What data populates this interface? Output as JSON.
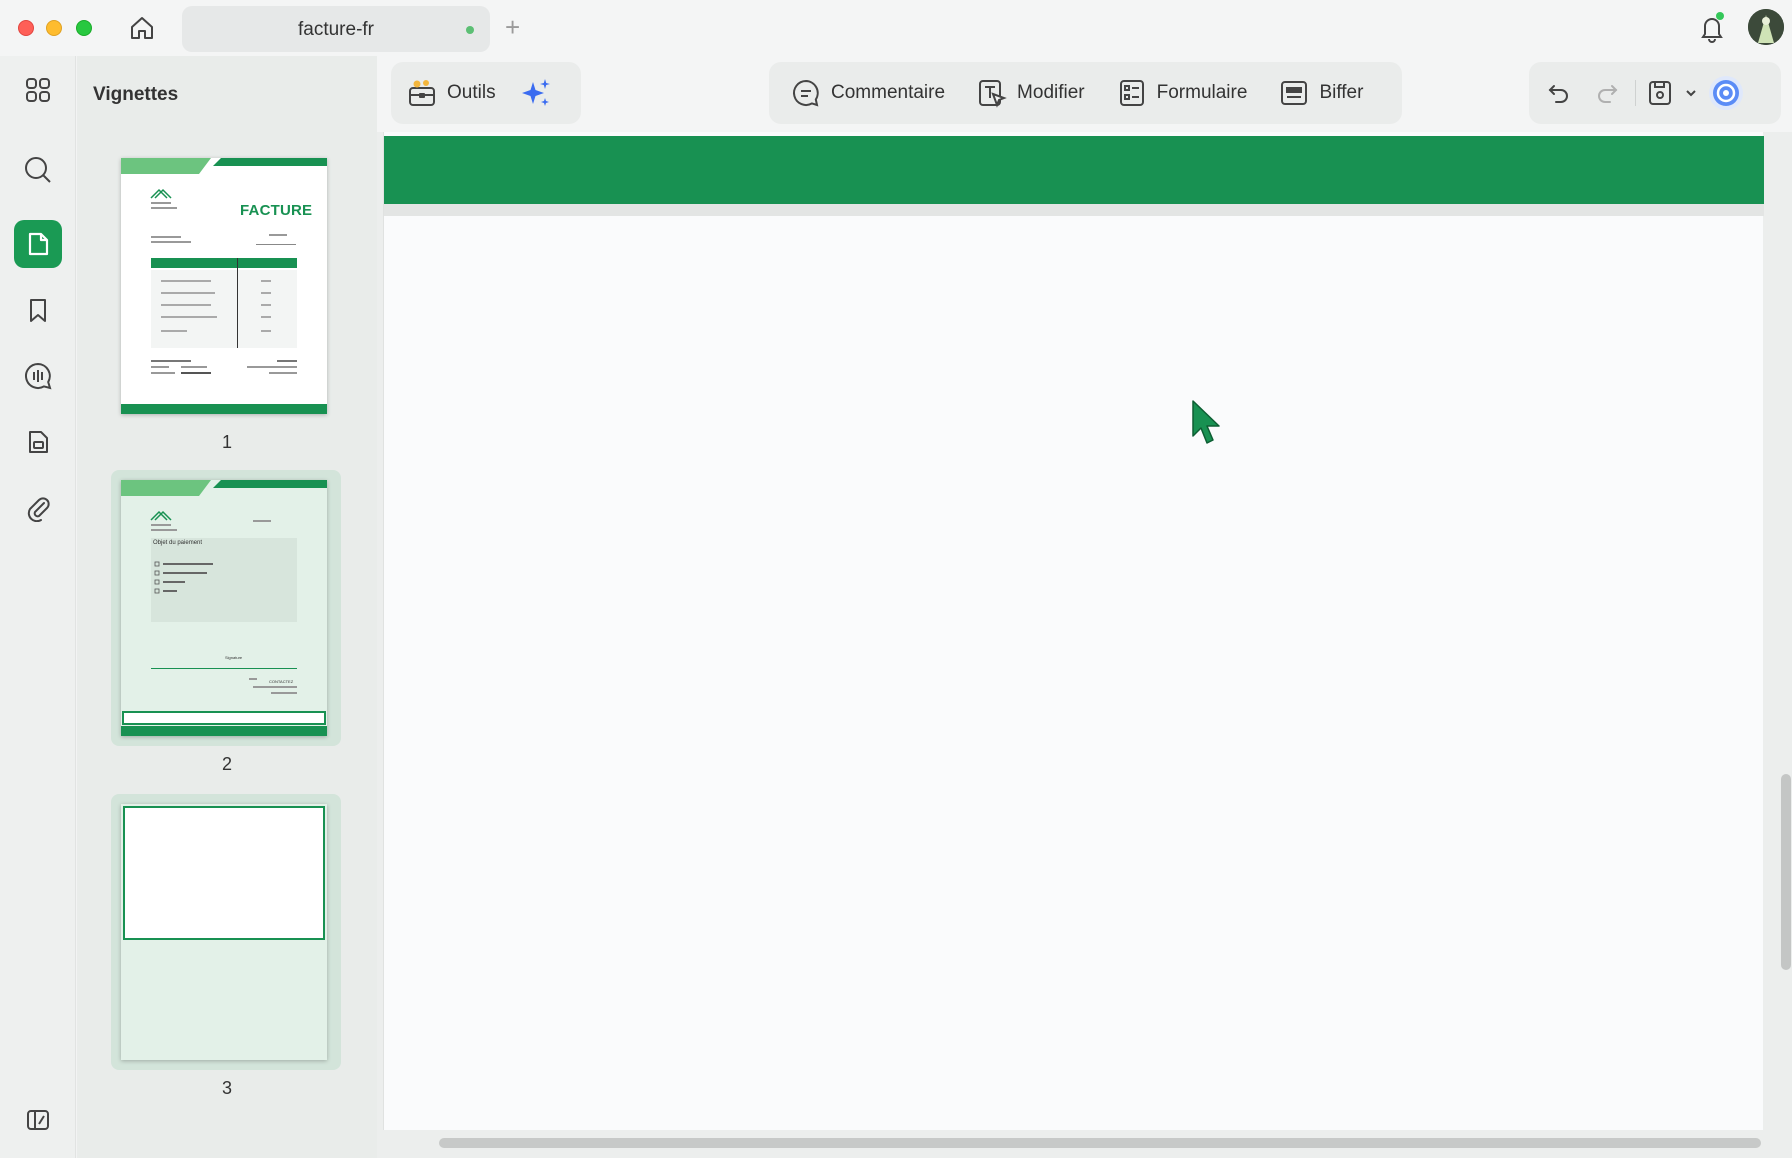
{
  "window": {
    "tab_title": "facture-fr",
    "new_tab_label": "+"
  },
  "sidebar": {
    "panel_title": "Vignettes",
    "rail_items": [
      "apps",
      "search",
      "thumbnails",
      "bookmarks",
      "comments",
      "pages",
      "attachments"
    ],
    "active_item": "thumbnails"
  },
  "thumbnails": [
    {
      "number": "1",
      "selected": false,
      "heading": "FACTURE"
    },
    {
      "number": "2",
      "selected": true,
      "section_title": "Objet du paiement",
      "signature_label": "Signature",
      "contact_label": "CONTACTEZ"
    },
    {
      "number": "3",
      "selected": true
    }
  ],
  "toolbar": {
    "tools_label": "Outils",
    "comment_label": "Commentaire",
    "edit_label": "Modifier",
    "form_label": "Formulaire",
    "redact_label": "Biffer"
  },
  "colors": {
    "accent": "#1a9a54",
    "band": "#189152",
    "ai": "#3b6cf0"
  }
}
